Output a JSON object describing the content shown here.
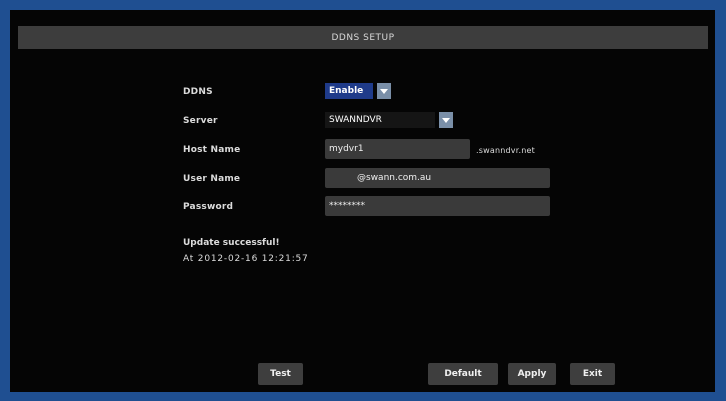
{
  "title": "DDNS SETUP",
  "form": {
    "ddns": {
      "label": "DDNS",
      "value": "Enable"
    },
    "server": {
      "label": "Server",
      "value": "SWANNDVR"
    },
    "host_name": {
      "label": "Host Name",
      "value": "mydvr1",
      "suffix": ".swanndvr.net"
    },
    "user_name": {
      "label": "User Name",
      "value": "@swann.com.au"
    },
    "password": {
      "label": "Password",
      "value": "********"
    }
  },
  "status": {
    "message": "Update successful!",
    "timestamp": "At 2012-02-16 12:21:57"
  },
  "buttons": {
    "test": "Test",
    "default": "Default",
    "apply": "Apply",
    "exit": "Exit"
  },
  "colors": {
    "border": "#1f4f91",
    "background": "#050505",
    "field": "#3a3a3a",
    "selected": "#1f3b8a"
  },
  "icons": {
    "dropdown": "chevron-down-icon"
  }
}
